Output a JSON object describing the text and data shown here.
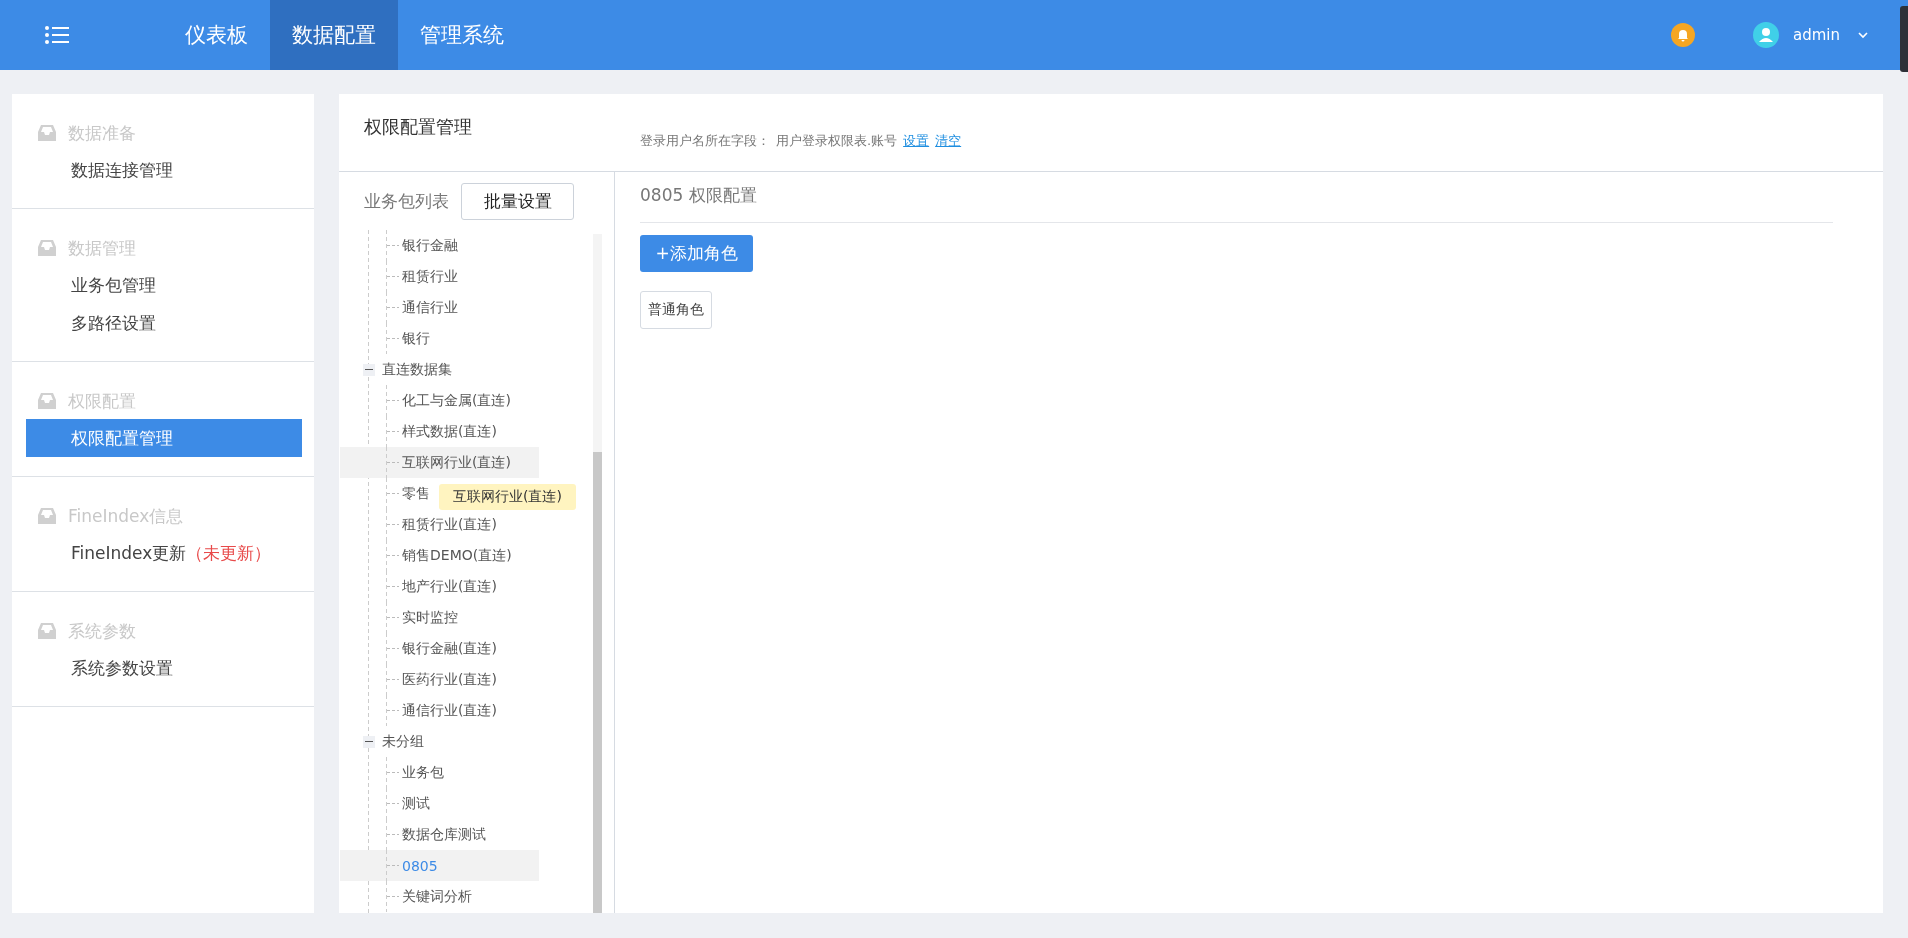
{
  "topbar": {
    "tabs": [
      {
        "label": "仪表板",
        "selected": false
      },
      {
        "label": "数据配置",
        "selected": true
      },
      {
        "label": "管理系统",
        "selected": false
      }
    ],
    "user": "admin"
  },
  "sidebar": [
    {
      "title": "数据准备",
      "items": [
        {
          "label": "数据连接管理",
          "selected": false
        }
      ]
    },
    {
      "title": "数据管理",
      "items": [
        {
          "label": "业务包管理",
          "selected": false
        },
        {
          "label": "多路径设置",
          "selected": false
        }
      ]
    },
    {
      "title": "权限配置",
      "items": [
        {
          "label": "权限配置管理",
          "selected": true
        }
      ]
    },
    {
      "title": "FineIndex信息",
      "items": [
        {
          "label": "FineIndex更新",
          "note": "（未更新）",
          "selected": false
        }
      ]
    },
    {
      "title": "系统参数",
      "items": [
        {
          "label": "系统参数设置",
          "selected": false
        }
      ]
    }
  ],
  "header": {
    "title": "权限配置管理",
    "field_label": "登录用户名所在字段：",
    "field_value": "用户登录权限表.账号",
    "links": [
      "设置",
      "清空"
    ]
  },
  "package_list": {
    "label": "业务包列表",
    "button": "批量设置",
    "tree": [
      {
        "children": [
          {
            "label": "银行金融",
            "selected": false,
            "hovered": false
          },
          {
            "label": "租赁行业",
            "selected": false,
            "hovered": false
          },
          {
            "label": "通信行业",
            "selected": false,
            "hovered": false
          },
          {
            "label": "银行",
            "selected": false,
            "hovered": false
          }
        ]
      },
      {
        "label": "直连数据集",
        "expanded": true,
        "children": [
          {
            "label": "化工与金属(直连)",
            "selected": false,
            "hovered": false
          },
          {
            "label": "样式数据(直连)",
            "selected": false,
            "hovered": false
          },
          {
            "label": "互联网行业(直连)",
            "selected": false,
            "hovered": true
          },
          {
            "label": "零售",
            "selected": false,
            "hovered": false
          },
          {
            "label": "租赁行业(直连)",
            "selected": false,
            "hovered": false
          },
          {
            "label": "销售DEMO(直连)",
            "selected": false,
            "hovered": false
          },
          {
            "label": "地产行业(直连)",
            "selected": false,
            "hovered": false
          },
          {
            "label": "实时监控",
            "selected": false,
            "hovered": false
          },
          {
            "label": "银行金融(直连)",
            "selected": false,
            "hovered": false
          },
          {
            "label": "医药行业(直连)",
            "selected": false,
            "hovered": false
          },
          {
            "label": "通信行业(直连)",
            "selected": false,
            "hovered": false
          }
        ]
      },
      {
        "label": "未分组",
        "expanded": true,
        "children": [
          {
            "label": "业务包",
            "selected": false,
            "hovered": false
          },
          {
            "label": "测试",
            "selected": false,
            "hovered": false
          },
          {
            "label": "数据仓库测试",
            "selected": false,
            "hovered": false
          },
          {
            "label": "0805",
            "selected": true,
            "hovered": false
          },
          {
            "label": "关键词分析",
            "selected": false,
            "hovered": false
          }
        ]
      }
    ],
    "tooltip": "互联网行业(直连)"
  },
  "config": {
    "title": "0805 权限配置",
    "add_button": "+添加角色",
    "roles": [
      "普通角色"
    ]
  }
}
